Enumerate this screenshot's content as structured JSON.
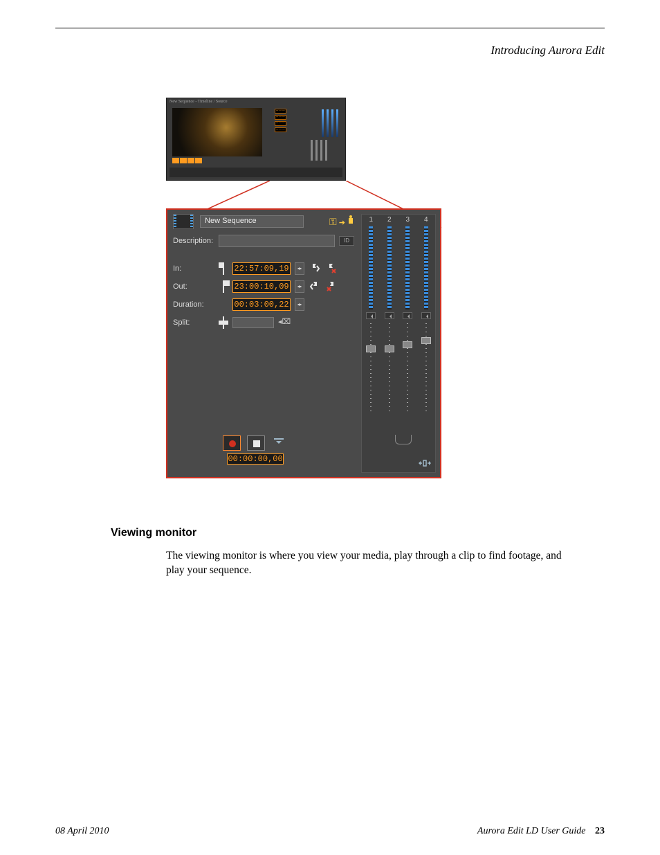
{
  "header": {
    "chapter_title": "Introducing Aurora Edit"
  },
  "thumbnail": {
    "title": "New Sequence - Timeline / Source"
  },
  "panel": {
    "sequence_name": "New Sequence",
    "description_label": "Description:",
    "description_value": "",
    "id_badge": "ID",
    "rows": {
      "in": {
        "label": "In:",
        "tc": "22:57:09,19"
      },
      "out": {
        "label": "Out:",
        "tc": "23:00:10,09"
      },
      "duration": {
        "label": "Duration:",
        "tc": "00:03:00,22"
      },
      "split": {
        "label": "Split:"
      }
    },
    "bottom_tc": "00:00:00,00",
    "channels": [
      "1",
      "2",
      "3",
      "4"
    ]
  },
  "section": {
    "heading": "Viewing monitor",
    "body": "The viewing monitor is where you view your media, play through a clip to find footage, and play your sequence."
  },
  "footer": {
    "date": "08 April 2010",
    "guide": "Aurora Edit LD User Guide",
    "page": "23"
  }
}
